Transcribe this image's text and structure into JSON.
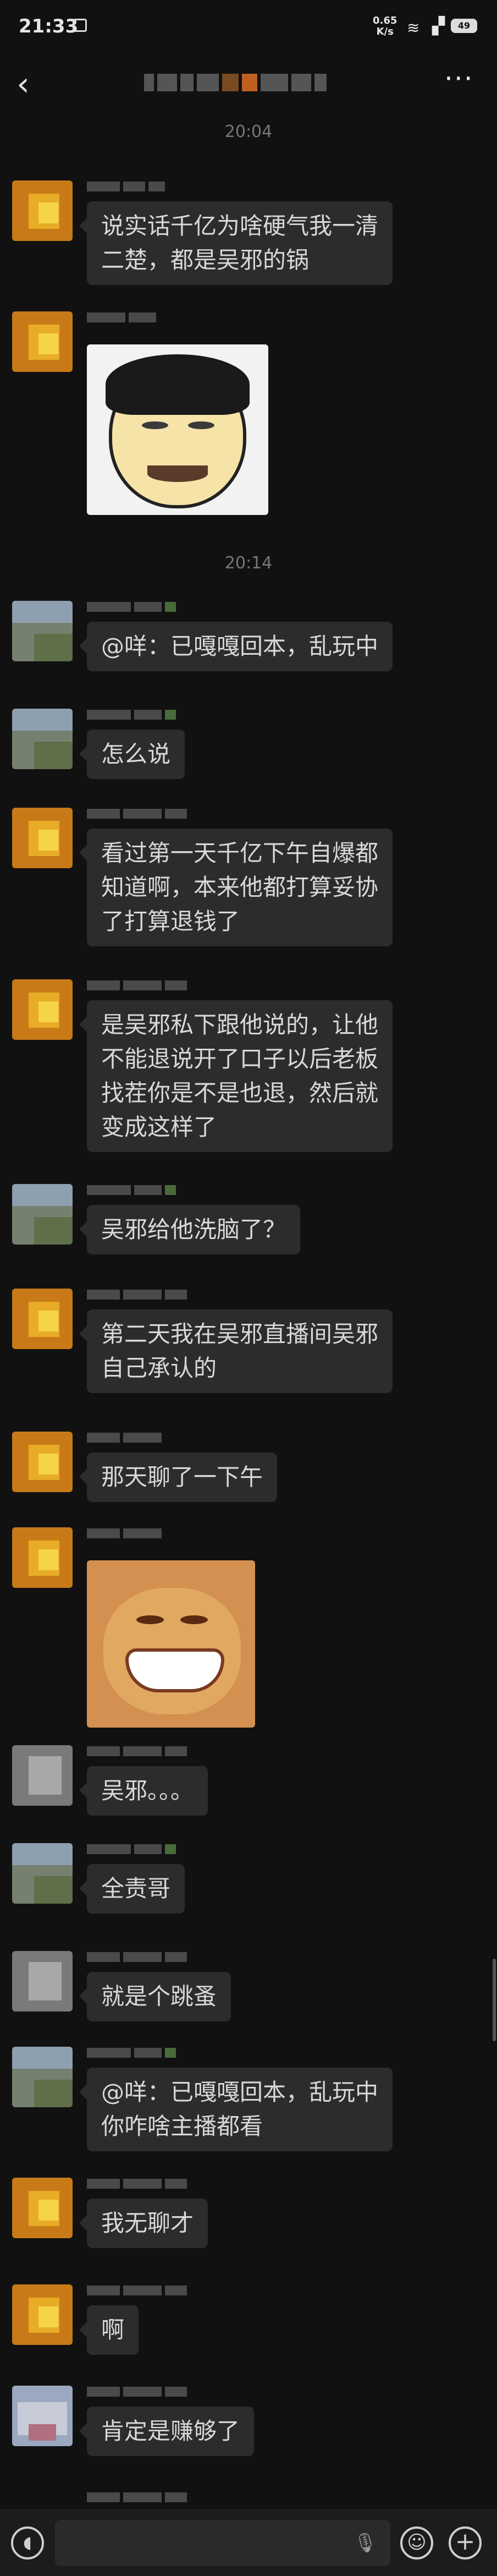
{
  "status_bar": {
    "time": "21:33",
    "net_speed": "0.65\nK/s",
    "battery": "49"
  },
  "nav": {
    "back_icon": "back-chevron-icon",
    "more_label": "···"
  },
  "timestamps": [
    "20:04",
    "20:14"
  ],
  "messages": [
    {
      "avatar": "orange",
      "type": "text",
      "text": "说实话千亿为啥硬气我一清\n二楚，都是吴邪的锅"
    },
    {
      "avatar": "orange",
      "type": "sticker",
      "sticker": "face"
    },
    {
      "avatar": "greygreen",
      "type": "text",
      "text": "@咩：已嘎嘎回本，乱玩中"
    },
    {
      "avatar": "greygreen",
      "type": "text",
      "text": "怎么说"
    },
    {
      "avatar": "orange",
      "type": "text",
      "text": "看过第一天千亿下午自爆都\n知道啊，本来他都打算妥协\n了打算退钱了"
    },
    {
      "avatar": "orange",
      "type": "text",
      "text": "是吴邪私下跟他说的，让他\n不能退说开了口子以后老板\n找茬你是不是也退，然后就\n变成这样了"
    },
    {
      "avatar": "greygreen",
      "type": "text",
      "text": "吴邪给他洗脑了？"
    },
    {
      "avatar": "orange",
      "type": "text",
      "text": "第二天我在吴邪直播间吴邪\n自己承认的"
    },
    {
      "avatar": "orange",
      "type": "text",
      "text": "那天聊了一下午"
    },
    {
      "avatar": "orange",
      "type": "sticker",
      "sticker": "cat"
    },
    {
      "avatar": "grey",
      "type": "text",
      "text": "吴邪。。。"
    },
    {
      "avatar": "greygreen",
      "type": "text",
      "text": "全责哥"
    },
    {
      "avatar": "grey",
      "type": "text",
      "text": "就是个跳蚤"
    },
    {
      "avatar": "greygreen",
      "type": "text",
      "text": "@咩：已嘎嘎回本，乱玩中\n你咋啥主播都看"
    },
    {
      "avatar": "orange",
      "type": "text",
      "text": "我无聊才"
    },
    {
      "avatar": "orange",
      "type": "text",
      "text": "啊"
    },
    {
      "avatar": "blue",
      "type": "text",
      "text": "肯定是赚够了"
    }
  ],
  "input_bar": {
    "voice_icon": "voice-icon",
    "mic_icon": "mic-icon",
    "emoji_icon": "emoji-icon",
    "plus_icon": "plus-icon"
  }
}
